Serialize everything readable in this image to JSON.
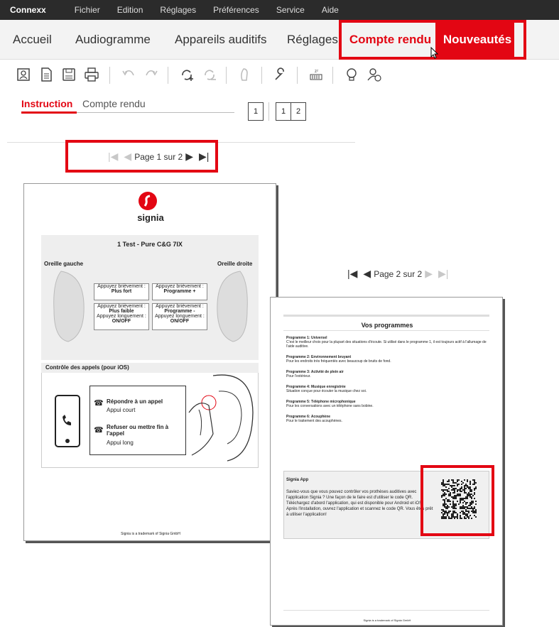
{
  "menu": {
    "brand": "Connexx",
    "items": [
      "Fichier",
      "Edition",
      "Réglages",
      "Préférences",
      "Service",
      "Aide"
    ]
  },
  "nav": {
    "items": [
      "Accueil",
      "Audiogramme",
      "Appareils auditifs",
      "Réglages"
    ],
    "active": "Compte rendu",
    "new": "Nouveautés"
  },
  "toolbar": {
    "icons": [
      "patient-icon",
      "document-icon",
      "save-icon",
      "print-icon",
      "undo-icon",
      "redo-icon",
      "add-sync-icon",
      "sync-icon",
      "hearing-aid-icon",
      "wrench-icon",
      "sleep-meter-icon",
      "lightbulb-icon",
      "user-info-icon"
    ]
  },
  "tabs": {
    "instruction": "Instruction",
    "report": "Compte rendu"
  },
  "layout_buttons": {
    "one": "1",
    "two_a": "1",
    "two_b": "2"
  },
  "pager1": {
    "text": "Page 1 sur 2"
  },
  "pager2": {
    "text": "Page 2 sur 2"
  },
  "page1": {
    "logo": "signia",
    "title": "1 Test - Pure C&G 7IX",
    "left_ear": "Oreille gauche",
    "right_ear": "Oreille droite",
    "box1_a": "Appuyez brièvement :",
    "box1_b": "Plus fort",
    "box2_a": "Appuyez brièvement :",
    "box2_b": "Programme +",
    "box3_a": "Appuyez brièvement :",
    "box3_b": "Plus faible",
    "box3_c": "Appuyez longuement :",
    "box3_d": "ON/OFF",
    "box4_a": "Appuyez brièvement :",
    "box4_b": "Programme -",
    "box4_c": "Appuyez longuement :",
    "box4_d": "ON/OFF",
    "calls_title": "Contrôle des appels (pour iOS)",
    "answer": "Répondre à un appel",
    "answer_sub": "Appui court",
    "reject": "Refuser ou mettre fin à l'appel",
    "reject_sub": "Appui long",
    "footer": "Signia is a trademark of Signia GmbH"
  },
  "page2": {
    "title": "Vos programmes",
    "programs": [
      {
        "name": "Programme 1: Universel",
        "desc": "C'est le meilleur choix pour la plupart des situations d'écoute. Si utilisé dans le programme 1, il est toujours actif à l'allumage de l'aide auditive."
      },
      {
        "name": "Programme 2: Environnement bruyant",
        "desc": "Pour les endroits très fréquentés avec beaucoup de bruits de fond."
      },
      {
        "name": "Programme 3: Activité de plein air",
        "desc": "Pour l'extérieur."
      },
      {
        "name": "Programme 4: Musique enregistrée",
        "desc": "Situation conçue pour écouter la musique chez soi."
      },
      {
        "name": "Programme 5: Téléphone microphonique",
        "desc": "Pour les conversations avec un téléphone sans bobine."
      },
      {
        "name": "Programme 6: Acouphène",
        "desc": "Pour le traitement des acouphènes."
      }
    ],
    "app_title": "Signia App",
    "app_text1": "Saviez-vous que vous pouvez contrôler vos prothèses auditives avec l'application Signia ? Une façon de le faire est d'utiliser le code QR.",
    "app_text2": "Téléchargez d'abord l'application, qui est disponible pour Android et iOS.",
    "app_text3": "Après l'installation, ouvrez l'application et scannez le code QR. Vous êtes prêt à utiliser l'application!",
    "footer": "Signia is a trademark of Signia GmbH"
  },
  "colors": {
    "accent": "#e30613",
    "menubar": "#2b2b2b"
  }
}
